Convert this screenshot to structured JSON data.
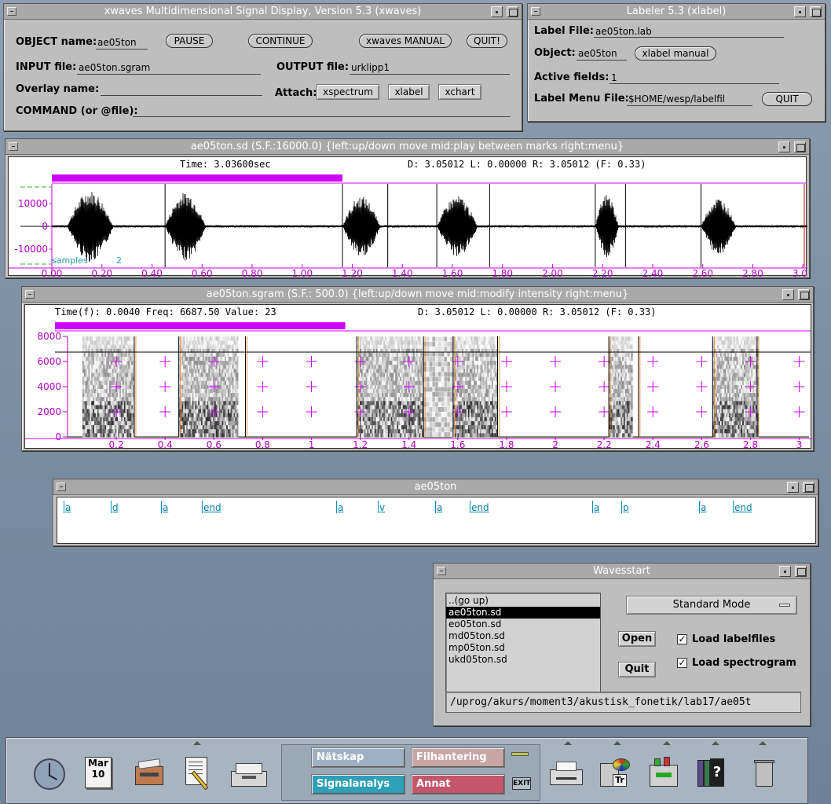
{
  "xwaves": {
    "title": "xwaves Multidimensional Signal Display, Version 5.3 (xwaves)",
    "object_label": "OBJECT name:",
    "object_value": "ae05ton",
    "pause": "PAUSE",
    "continue": "CONTINUE",
    "manual": "xwaves MANUAL",
    "quit": "QUIT!",
    "input_label": "INPUT file:",
    "input_value": "ae05ton.sgram",
    "output_label": "OUTPUT file:",
    "output_value": "urklipp1",
    "overlay_label": "Overlay name:",
    "attach_label": "Attach:",
    "attach_buttons": [
      "xspectrum",
      "xlabel",
      "xchart"
    ],
    "command_label": "COMMAND (or @file):"
  },
  "labeler": {
    "title": "Labeler 5.3 (xlabel)",
    "label_file_label": "Label File:",
    "label_file_value": "ae05ton.lab",
    "object_label": "Object:",
    "object_value": "ae05ton",
    "manual": "xlabel manual",
    "active_label": "Active fields:",
    "active_value": "1",
    "menu_label": "Label Menu File:",
    "menu_value": "$HOME/wesp/labelfil",
    "quit": "QUIT"
  },
  "waveform": {
    "title": "ae05ton.sd (S.F.:16000.0) {left:up/down move  mid:play between marks  right:menu}",
    "time_text": "Time:  3.03600sec",
    "status_text": "D: 3.05012   L:  0.00000   R:  3.05012  (F:     0.33)",
    "y_ticks": [
      "10000",
      "0",
      "-10000"
    ],
    "units_text": "samples",
    "units_value": "2",
    "x_ticks": [
      "0.00",
      "0.20",
      "0.40",
      "0.60",
      "0.80",
      "1.00",
      "1.20",
      "1.40",
      "1.60",
      "1.80",
      "2.00",
      "2.20",
      "2.40",
      "2.60",
      "2.80",
      "3.00"
    ],
    "cursor_fraction": 0.385
  },
  "spectrogram": {
    "title": "ae05ton.sgram (S.F.: 500.0) {left:up/down move  mid:modify intensity  right:menu}",
    "status_left": "Time(f):  0.0040 Freq:   6687.50   Value:   23",
    "status_right": "D: 3.05012   L:  0.00000   R:  3.05012  (F:     0.33)",
    "y_ticks": [
      "8000",
      "6000",
      "4000",
      "2000",
      "0"
    ],
    "x_ticks": [
      "0.2",
      "0.4",
      "0.6",
      "0.8",
      "1",
      "1.2",
      "1.4",
      "1.6",
      "1.8",
      "2",
      "2.2",
      "2.4",
      "2.6",
      "2.8",
      "3"
    ],
    "cursor_fraction": 0.385
  },
  "labels_window": {
    "title": "ae05ton",
    "labels": [
      "a",
      "d",
      "a",
      "end",
      "a",
      "v",
      "a",
      "end",
      "a",
      "p",
      "a",
      "end"
    ]
  },
  "wavesstart": {
    "title": "Wavesstart",
    "files": [
      "..(go up)",
      "ae05ton.sd",
      "eo05ton.sd",
      "md05ton.sd",
      "mp05ton.sd",
      "ukd05ton.sd"
    ],
    "selected_index": 1,
    "mode": "Standard Mode",
    "open": "Open",
    "quit": "Quit",
    "load_labelfiles": "Load labelfiles",
    "load_spectrogram": "Load spectrogram",
    "path": "/uprog/akurs/moment3/akustisk_fonetik/lab17/ae05t"
  },
  "dock": {
    "calendar_month": "Mar",
    "calendar_day": "10",
    "buttons": [
      "Nätskap",
      "Filhantering",
      "Signalanalys",
      "Annat"
    ],
    "exit": "EXIT"
  }
}
